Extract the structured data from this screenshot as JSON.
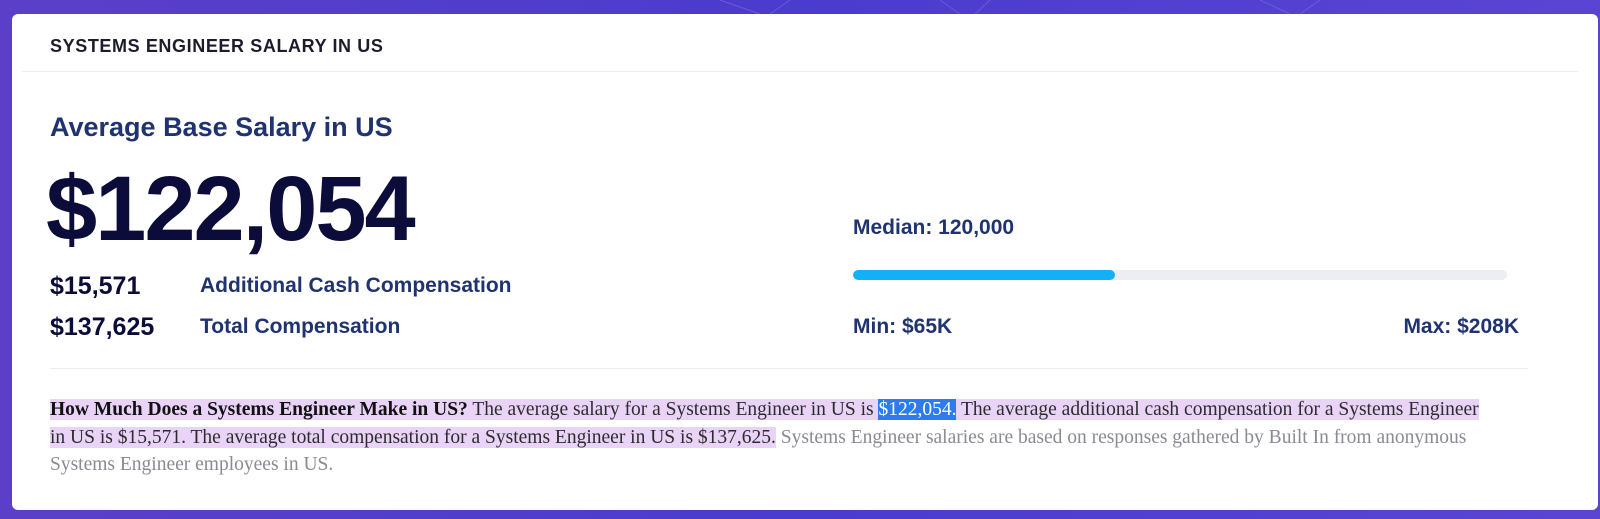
{
  "card": {
    "title": "SYSTEMS ENGINEER SALARY IN US"
  },
  "salary": {
    "average_title": "Average Base Salary in US",
    "average_value": "$122,054",
    "additional_cash_amount": "$15,571",
    "additional_cash_label": "Additional Cash Compensation",
    "total_amount": "$137,625",
    "total_label": "Total Compensation"
  },
  "range": {
    "median_label": "Median: 120,000",
    "min_label": "Min: $65K",
    "max_label": "Max: $208K",
    "bar_fill_fraction": 0.4,
    "bar_color": "#13b0f5"
  },
  "description": {
    "question": "How Much Does a Systems Engineer Make in US?",
    "sentence1_prefix": " The average salary for a Systems Engineer in US is ",
    "sentence1_value": "$122,054.",
    "sentence2": " The average additional cash compensation for a Systems Engineer in US is $15,571. The average total compensation for a Systems Engineer in US is $137,625.",
    "footnote": " Systems Engineer salaries are based on responses gathered by Built In from anonymous Systems Engineer employees in US."
  },
  "colors": {
    "background": "#4a3ccf",
    "heading": "#1e3370",
    "highlight": "#e9d4f7",
    "selection": "#2c7bf0"
  }
}
